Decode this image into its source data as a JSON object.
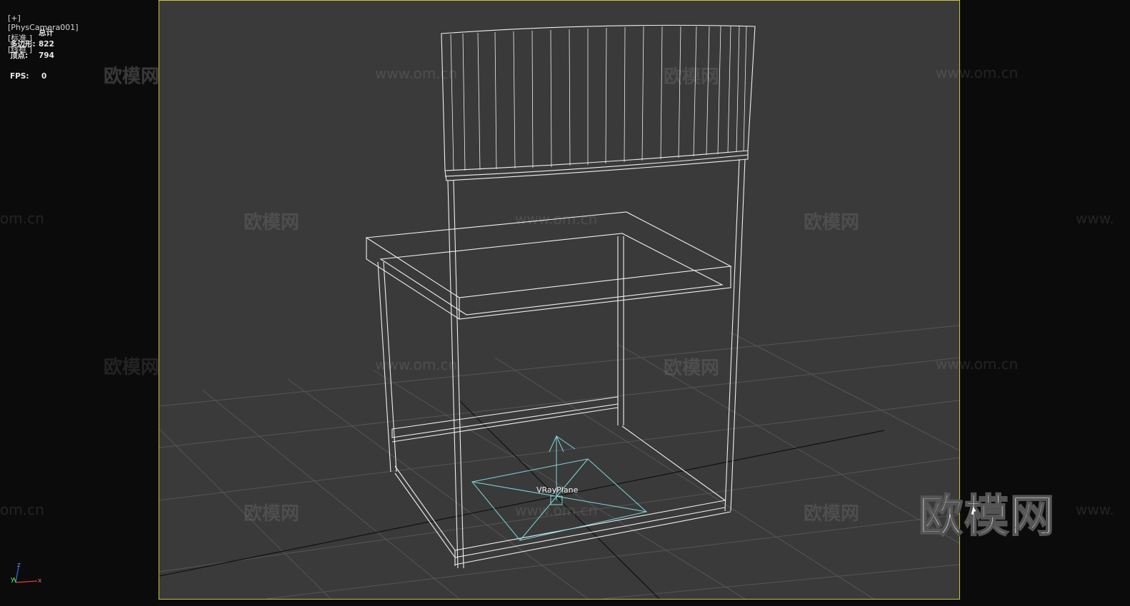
{
  "viewport": {
    "plus": "[+]",
    "camera": "[PhysCamera001]",
    "shading": "[标准 ]",
    "mode": "[线框 ]"
  },
  "stats": {
    "header": "总计",
    "polygons_label": "多边形:",
    "polygons_value": "822",
    "vertices_label": "顶点:",
    "vertices_value": "794",
    "fps_label": "FPS:",
    "fps_value": "0"
  },
  "scene": {
    "object_label": "VRayPlane",
    "watermark_cn": "欧模网",
    "watermark_url": "www.om.cn",
    "watermark_url_partial": "om.cn",
    "watermark_url_cut": "www.",
    "logo": "欧模网"
  },
  "axis": {
    "z": "z",
    "x": "x",
    "y": "y"
  },
  "colors": {
    "background": "#3a3a3a",
    "border": "#c8c832",
    "wire": "#f0f0f0",
    "helper": "#7fd8d8"
  }
}
